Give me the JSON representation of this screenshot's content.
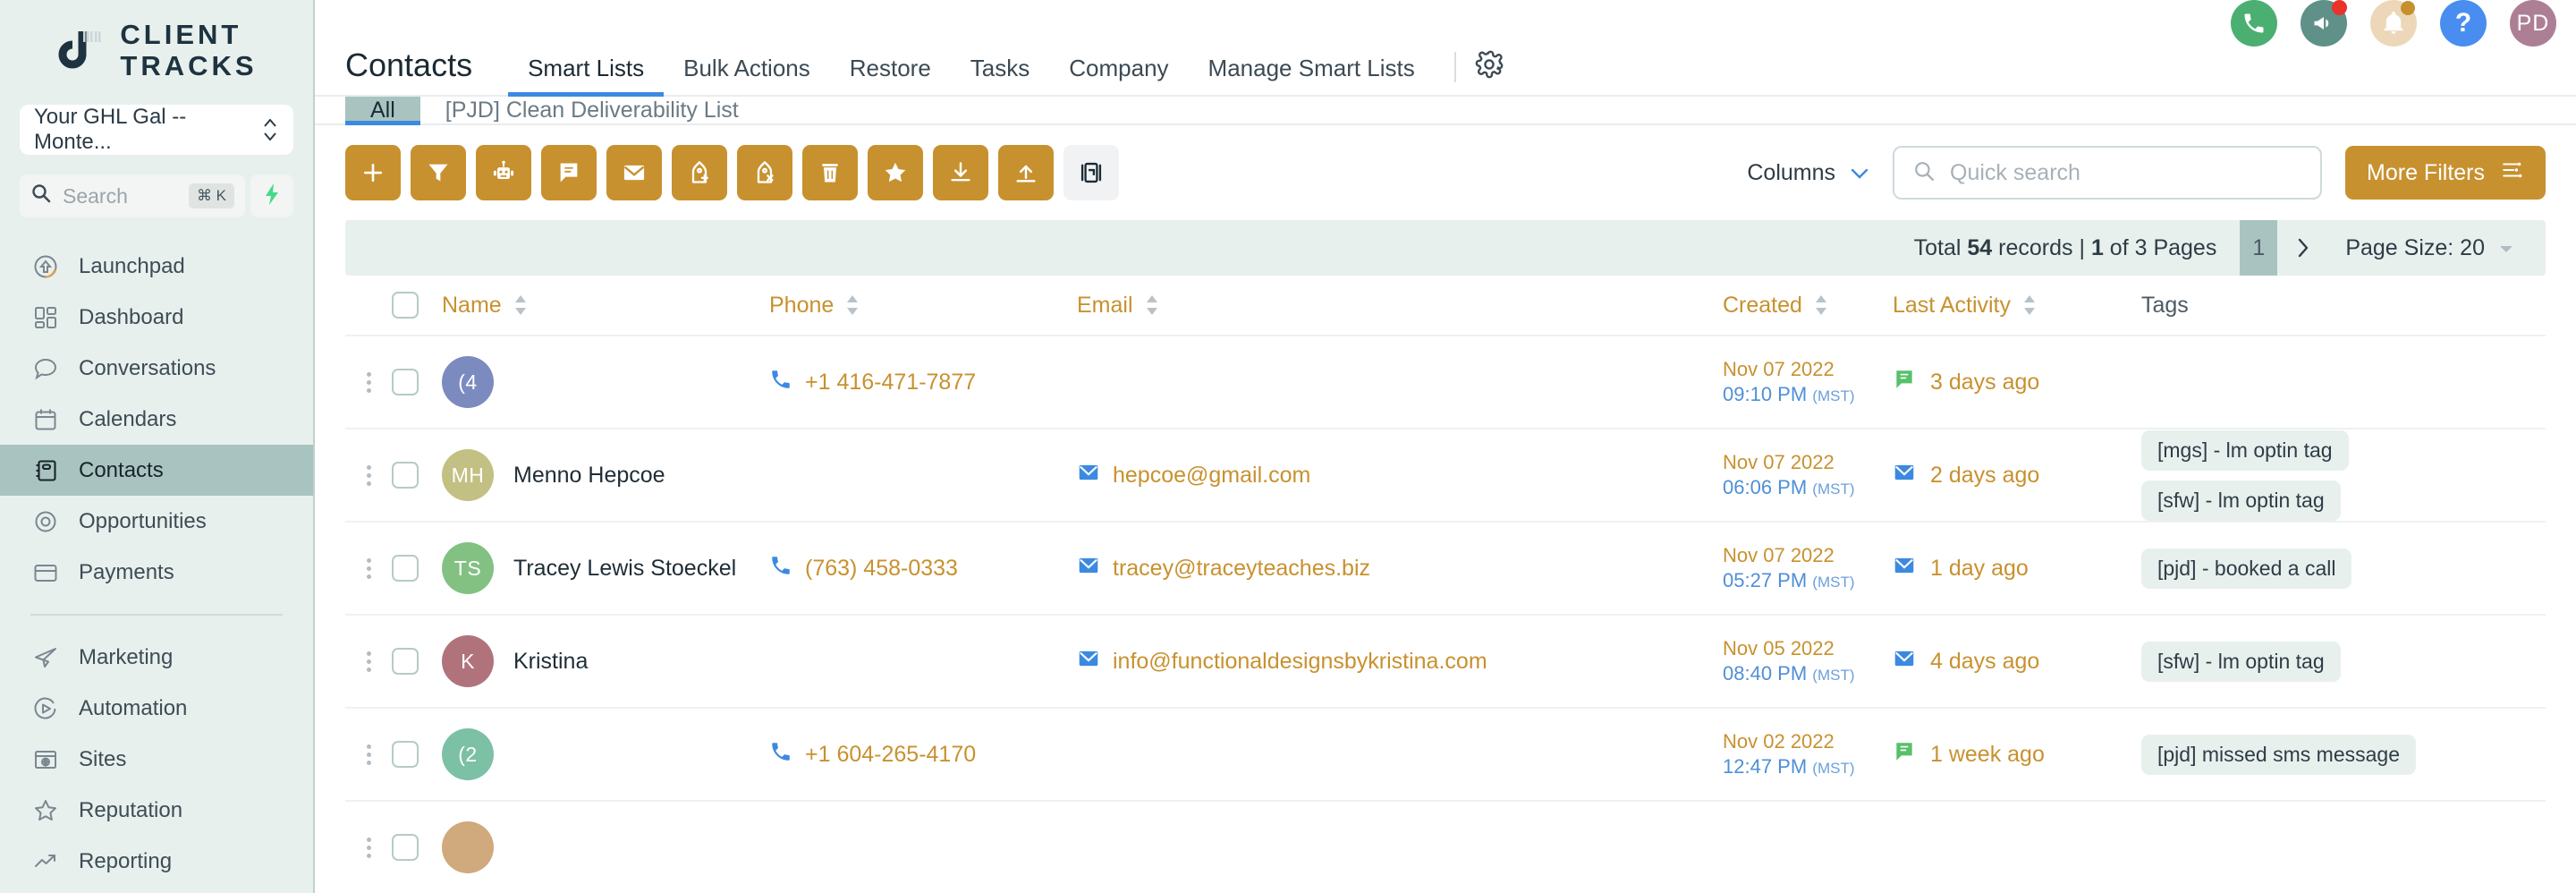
{
  "brand": {
    "line1": "CLIENT",
    "line2": "TRACKS",
    "logo_icon": "client-tracks-logo"
  },
  "sidebar": {
    "account_selector": {
      "value": "Your GHL Gal -- Monte...",
      "icon": "chevron-updown-icon"
    },
    "search": {
      "placeholder": "Search",
      "shortcut": "⌘ K",
      "icon": "search-icon",
      "bolt_icon": "lightning-bolt-icon"
    },
    "items": [
      {
        "label": "Launchpad",
        "icon": "rocket-launch-icon",
        "active": false
      },
      {
        "label": "Dashboard",
        "icon": "dashboard-grid-icon",
        "active": false
      },
      {
        "label": "Conversations",
        "icon": "chat-bubble-icon",
        "active": false
      },
      {
        "label": "Calendars",
        "icon": "calendar-icon",
        "active": false
      },
      {
        "label": "Contacts",
        "icon": "contacts-book-icon",
        "active": true
      },
      {
        "label": "Opportunities",
        "icon": "target-icon",
        "active": false
      },
      {
        "label": "Payments",
        "icon": "credit-card-icon",
        "active": false
      }
    ],
    "items2": [
      {
        "label": "Marketing",
        "icon": "paper-plane-icon",
        "active": false
      },
      {
        "label": "Automation",
        "icon": "play-circle-icon",
        "active": false
      },
      {
        "label": "Sites",
        "icon": "browser-globe-icon",
        "active": false
      },
      {
        "label": "Reputation",
        "icon": "star-outline-icon",
        "active": false
      },
      {
        "label": "Reporting",
        "icon": "trend-up-icon",
        "active": false
      }
    ]
  },
  "topbar": {
    "icons": [
      {
        "name": "phone-call-icon",
        "glyph": "☎",
        "bg": "#4caf72",
        "badge": ""
      },
      {
        "name": "megaphone-icon",
        "glyph": "📣",
        "bg": "#5f9188",
        "badge": "red"
      },
      {
        "name": "notifications-bell-icon",
        "glyph": "🔔",
        "bg": "#ecd8b8",
        "badge": "gold"
      },
      {
        "name": "help-question-icon",
        "glyph": "?",
        "bg": "#4a8df0",
        "badge": ""
      }
    ],
    "avatar": {
      "initials": "PD",
      "bg": "#ad7f95"
    }
  },
  "header": {
    "title": "Contacts",
    "tabs": [
      {
        "label": "Smart Lists",
        "active": true
      },
      {
        "label": "Bulk Actions",
        "active": false
      },
      {
        "label": "Restore",
        "active": false
      },
      {
        "label": "Tasks",
        "active": false
      },
      {
        "label": "Company",
        "active": false
      },
      {
        "label": "Manage Smart Lists",
        "active": false
      }
    ],
    "gear_icon": "gear-icon"
  },
  "subtabs": [
    {
      "label": "All",
      "active": true
    },
    {
      "label": "[PJD] Clean Deliverability List",
      "active": false
    }
  ],
  "toolbar": {
    "accent_color": "#c8912f",
    "actions": [
      {
        "name": "add-contact-button",
        "icon": "plus-icon"
      },
      {
        "name": "filter-button",
        "icon": "funnel-icon"
      },
      {
        "name": "add-to-automation-button",
        "icon": "robot-icon"
      },
      {
        "name": "send-sms-button",
        "icon": "message-icon"
      },
      {
        "name": "send-email-button",
        "icon": "envelope-icon"
      },
      {
        "name": "add-tag-button",
        "icon": "tag-plus-icon"
      },
      {
        "name": "remove-tag-button",
        "icon": "tag-remove-icon"
      },
      {
        "name": "delete-button",
        "icon": "trash-icon"
      },
      {
        "name": "favorite-button",
        "icon": "star-filled-icon"
      },
      {
        "name": "import-button",
        "icon": "download-icon"
      },
      {
        "name": "export-button",
        "icon": "upload-icon"
      },
      {
        "name": "merge-button",
        "icon": "merge-contacts-icon",
        "ghost": true
      }
    ],
    "columns_label": "Columns",
    "columns_caret_icon": "chevron-down-icon",
    "search_placeholder": "Quick search",
    "search_value": "",
    "search_icon": "search-icon",
    "more_filters_label": "More Filters",
    "more_filters_icon": "sliders-icon"
  },
  "pagination": {
    "total_prefix": "Total",
    "total_count": "54",
    "records_word": "records",
    "separator": "|",
    "current_page": "1",
    "of_pages": "of 3 Pages",
    "page_number": "1",
    "next_icon": "chevron-right-icon",
    "page_size_label": "Page Size: 20",
    "page_size_caret_icon": "caret-down-icon"
  },
  "table": {
    "columns": [
      {
        "key": "name",
        "label": "Name",
        "sortable": true
      },
      {
        "key": "phone",
        "label": "Phone",
        "sortable": true
      },
      {
        "key": "email",
        "label": "Email",
        "sortable": true
      },
      {
        "key": "created",
        "label": "Created",
        "sortable": true
      },
      {
        "key": "activity",
        "label": "Last Activity",
        "sortable": true
      },
      {
        "key": "tags",
        "label": "Tags",
        "sortable": false
      }
    ],
    "rows": [
      {
        "avatar_text": "(4",
        "avatar_bg": "#7b8bc0",
        "name": "",
        "phone": "+1 416-471-7877",
        "email": "",
        "created_date": "Nov 07 2022",
        "created_time": "09:10 PM",
        "created_tz": "(MST)",
        "activity": "3 days ago",
        "activity_icon": "sms-message-icon",
        "activity_icon_color": "#57c06a",
        "tags": []
      },
      {
        "avatar_text": "MH",
        "avatar_bg": "#c2c082",
        "name": "Menno Hepcoe",
        "phone": "",
        "email": "hepcoe@gmail.com",
        "created_date": "Nov 07 2022",
        "created_time": "06:06 PM",
        "created_tz": "(MST)",
        "activity": "2 days ago",
        "activity_icon": "email-icon",
        "activity_icon_color": "#3c8ae0",
        "tags": [
          "[mgs] - lm optin tag",
          "[sfw] - lm optin tag"
        ]
      },
      {
        "avatar_text": "TS",
        "avatar_bg": "#83c183",
        "name": "Tracey Lewis Stoeckel",
        "phone": "(763) 458-0333",
        "email": "tracey@traceyteaches.biz",
        "created_date": "Nov 07 2022",
        "created_time": "05:27 PM",
        "created_tz": "(MST)",
        "activity": "1 day ago",
        "activity_icon": "email-icon",
        "activity_icon_color": "#3c8ae0",
        "tags": [
          "[pjd] - booked a call"
        ]
      },
      {
        "avatar_text": "K",
        "avatar_bg": "#b0737c",
        "name": "Kristina",
        "phone": "",
        "email": "info@functionaldesignsbykristina.com",
        "created_date": "Nov 05 2022",
        "created_time": "08:40 PM",
        "created_tz": "(MST)",
        "activity": "4 days ago",
        "activity_icon": "email-icon",
        "activity_icon_color": "#3c8ae0",
        "tags": [
          "[sfw] - lm optin tag"
        ]
      },
      {
        "avatar_text": "(2",
        "avatar_bg": "#7cc0a6",
        "name": "",
        "phone": "+1 604-265-4170",
        "email": "",
        "created_date": "Nov 02 2022",
        "created_time": "12:47 PM",
        "created_tz": "(MST)",
        "activity": "1 week ago",
        "activity_icon": "sms-message-icon",
        "activity_icon_color": "#57c06a",
        "tags": [
          "[pjd] missed sms message"
        ]
      },
      {
        "avatar_text": "",
        "avatar_bg": "#d0a97c",
        "name": "",
        "phone": "",
        "email": "",
        "created_date": "",
        "created_time": "",
        "created_tz": "",
        "activity": "",
        "activity_icon": "",
        "activity_icon_color": "",
        "tags": []
      }
    ]
  }
}
